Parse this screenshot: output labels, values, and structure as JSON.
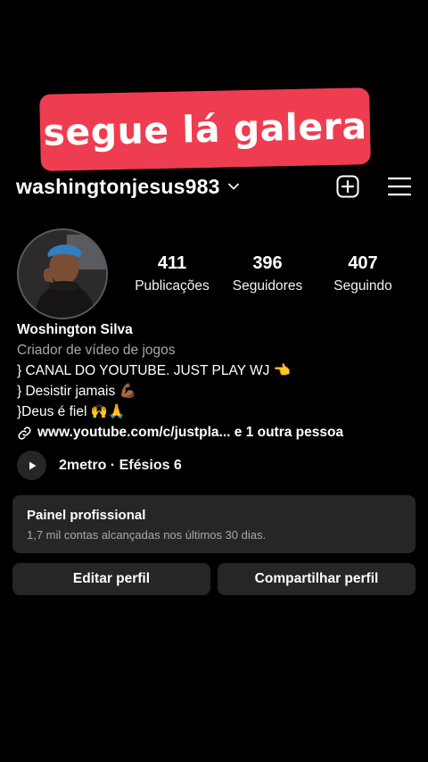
{
  "overlay": {
    "caption": "segue lá galera"
  },
  "header": {
    "username": "washingtonjesus983",
    "icons": [
      "chevron-down-icon",
      "add-icon",
      "menu-icon"
    ]
  },
  "profile": {
    "avatar": "profile-photo",
    "stats": [
      {
        "value": "411",
        "label": "Publicações"
      },
      {
        "value": "396",
        "label": "Seguidores"
      },
      {
        "value": "407",
        "label": "Seguindo"
      }
    ]
  },
  "bio": {
    "name": "Woshington Silva",
    "category": "Criador de vídeo de jogos",
    "lines": [
      "} CANAL DO YOUTUBE. JUST PLAY WJ 👈",
      "} Desistir jamais 💪🏾",
      "}Deus é fiel 🙌🙏"
    ],
    "link": "www.youtube.com/c/justpla... e 1 outra pessoa"
  },
  "music": {
    "text": "2metro · Efésios 6"
  },
  "pro_panel": {
    "title": "Painel profissional",
    "subtitle": "1,7 mil contas alcançadas nos últimos 30 dias."
  },
  "buttons": {
    "edit": "Editar perfil",
    "share": "Compartilhar perfil"
  }
}
